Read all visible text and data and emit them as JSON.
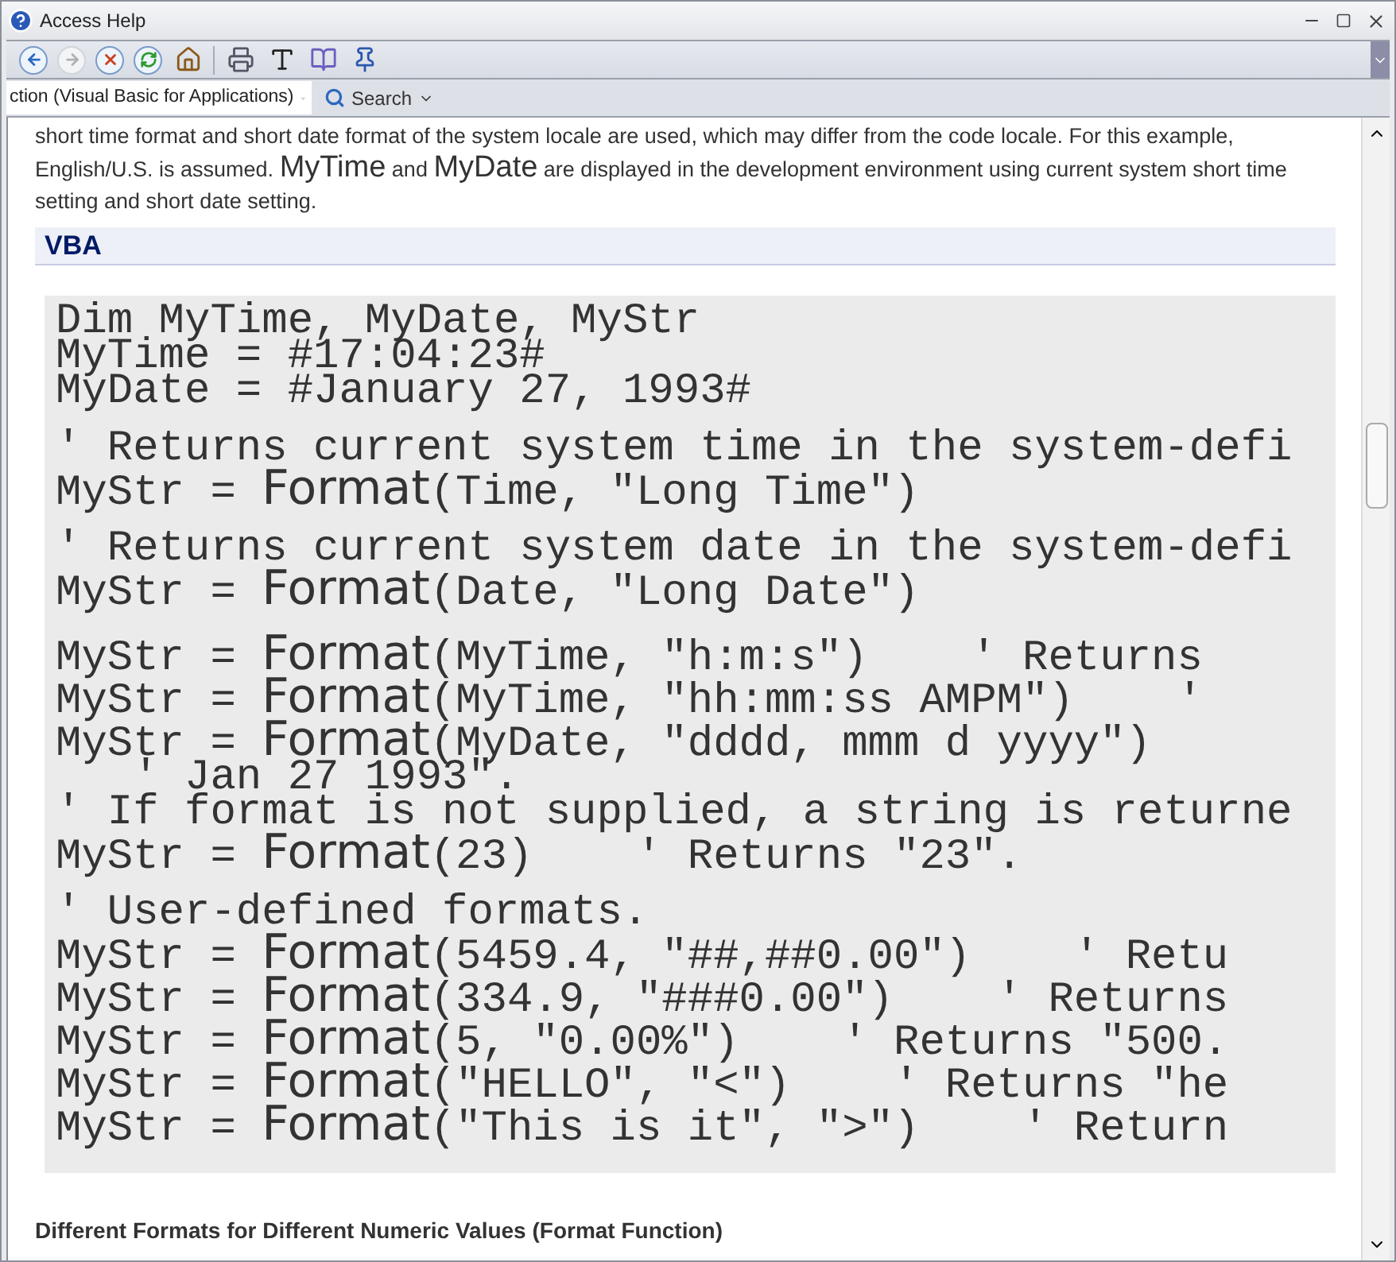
{
  "window": {
    "title": "Access Help"
  },
  "toolbar": [
    {
      "kind": "back",
      "disabled": false
    },
    {
      "kind": "forward",
      "disabled": true
    },
    {
      "kind": "stop",
      "disabled": false
    },
    {
      "kind": "refresh",
      "disabled": false
    },
    {
      "kind": "home",
      "disabled": false
    },
    {
      "kind": "print",
      "disabled": false
    },
    {
      "kind": "textsize",
      "disabled": false
    },
    {
      "kind": "book",
      "disabled": false
    },
    {
      "kind": "pin",
      "disabled": false
    }
  ],
  "address": {
    "value": "ction (Visual Basic for Applications)"
  },
  "search": {
    "label": "Search"
  },
  "intro": [
    {
      "text": "short time format and short date format of the system locale are used, which may differ from the code locale. For this example, English/U.S. is assumed. ",
      "kind": "plain"
    },
    {
      "text": "MyTime",
      "kind": "large"
    },
    {
      "text": " and ",
      "kind": "plain"
    },
    {
      "text": "MyDate",
      "kind": "large"
    },
    {
      "text": " are displayed in the development environment using current system short time setting and short date setting.",
      "kind": "plain"
    }
  ],
  "section_heading": "VBA",
  "code_blocks": [
    [
      [
        {
          "text": "Dim MyTime, MyDate, MyStr",
          "kind": "plain"
        }
      ],
      [
        {
          "text": "MyTime = #17:04:23#",
          "kind": "plain"
        }
      ],
      [
        {
          "text": "MyDate = #January 27, 1993#",
          "kind": "plain"
        }
      ]
    ],
    [
      [
        {
          "text": "' Returns current system time in the system-defi",
          "kind": "plain"
        }
      ],
      [
        {
          "text": "MyStr = ",
          "kind": "plain"
        },
        {
          "text": "Format",
          "kind": "keyword"
        },
        {
          "text": "(Time, \"Long Time\")",
          "kind": "plain"
        }
      ]
    ],
    [
      [
        {
          "text": "' Returns current system date in the system-defi",
          "kind": "plain"
        }
      ],
      [
        {
          "text": "MyStr = ",
          "kind": "plain"
        },
        {
          "text": "Format",
          "kind": "keyword"
        },
        {
          "text": "(Date, \"Long Date\")",
          "kind": "plain"
        }
      ]
    ],
    [
      [
        {
          "text": "MyStr = ",
          "kind": "plain"
        },
        {
          "text": "Format",
          "kind": "keyword"
        },
        {
          "text": "(MyTime, \"h:m:s\")    ' Returns",
          "kind": "plain"
        }
      ],
      [
        {
          "text": "MyStr = ",
          "kind": "plain"
        },
        {
          "text": "Format",
          "kind": "keyword"
        },
        {
          "text": "(MyTime, \"hh:mm:ss AMPM\")    '",
          "kind": "plain"
        }
      ],
      [
        {
          "text": "MyStr = ",
          "kind": "plain"
        },
        {
          "text": "Format",
          "kind": "keyword"
        },
        {
          "text": "(MyDate, \"dddd, mmm d yyyy\")",
          "kind": "plain"
        }
      ],
      [
        {
          "text": "   ' Jan 27 1993\".",
          "kind": "plain"
        }
      ],
      [
        {
          "text": "' If format is not supplied, a string is returne",
          "kind": "plain"
        }
      ],
      [
        {
          "text": "MyStr = ",
          "kind": "plain"
        },
        {
          "text": "Format",
          "kind": "keyword"
        },
        {
          "text": "(23)    ' Returns \"23\".",
          "kind": "plain"
        }
      ]
    ],
    [
      [
        {
          "text": "' User-defined formats.",
          "kind": "plain"
        }
      ],
      [
        {
          "text": "MyStr = ",
          "kind": "plain"
        },
        {
          "text": "Format",
          "kind": "keyword"
        },
        {
          "text": "(5459.4, \"##,##0.00\")    ' Retu",
          "kind": "plain"
        }
      ],
      [
        {
          "text": "MyStr = ",
          "kind": "plain"
        },
        {
          "text": "Format",
          "kind": "keyword"
        },
        {
          "text": "(334.9, \"###0.00\")    ' Returns",
          "kind": "plain"
        }
      ],
      [
        {
          "text": "MyStr = ",
          "kind": "plain"
        },
        {
          "text": "Format",
          "kind": "keyword"
        },
        {
          "text": "(5, \"0.00%\")    ' Returns \"500.",
          "kind": "plain"
        }
      ],
      [
        {
          "text": "MyStr = ",
          "kind": "plain"
        },
        {
          "text": "Format",
          "kind": "keyword"
        },
        {
          "text": "(\"HELLO\", \"<\")    ' Returns \"he",
          "kind": "plain"
        }
      ],
      [
        {
          "text": "MyStr = ",
          "kind": "plain"
        },
        {
          "text": "Format",
          "kind": "keyword"
        },
        {
          "text": "(\"This is it\", \">\")    ' Return",
          "kind": "plain"
        }
      ]
    ]
  ],
  "next_heading": "Different Formats for Different Numeric Values (Format Function)"
}
